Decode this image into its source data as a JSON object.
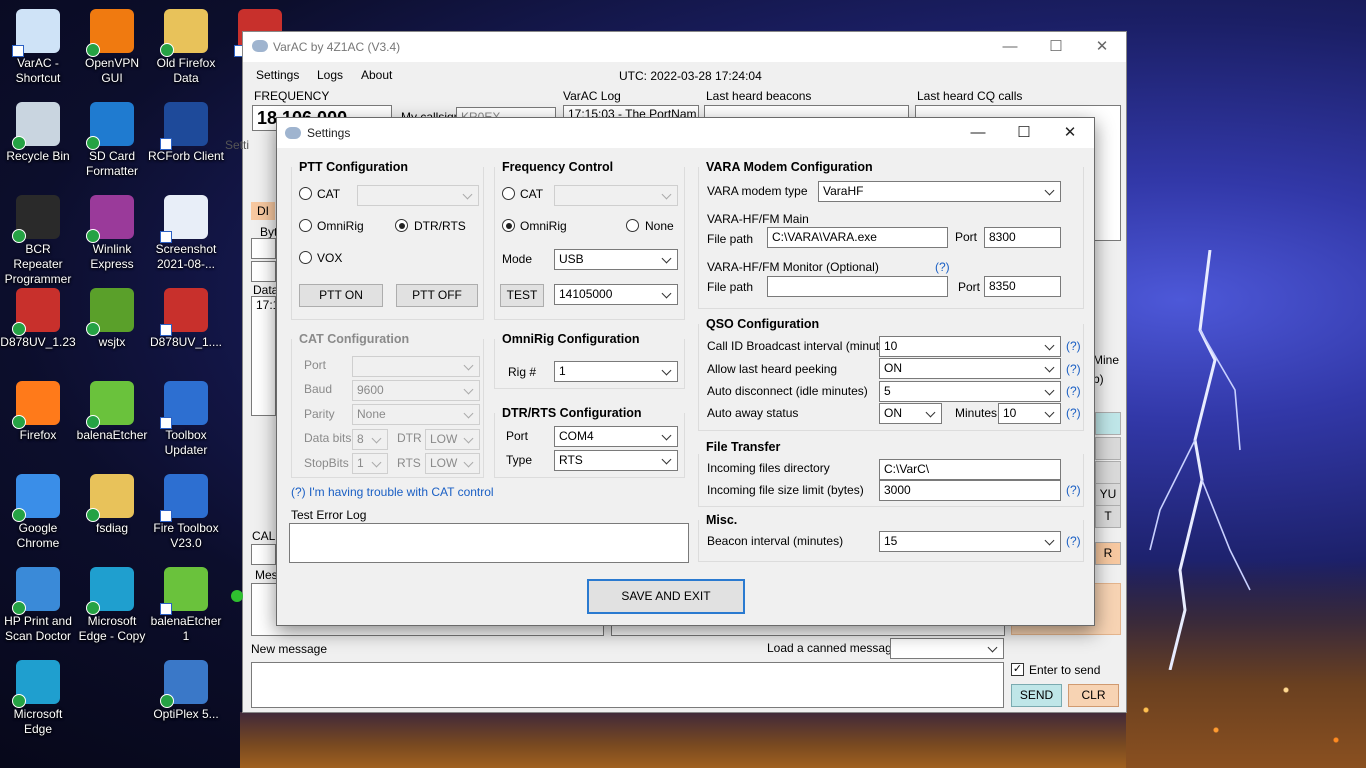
{
  "desktop": {
    "icons": [
      {
        "label": "VarAC - Shortcut",
        "icon": "chat-bubbles-icon",
        "color": "#cfe3f7"
      },
      {
        "label": "OpenVPN GUI",
        "icon": "openvpn-icon",
        "color": "#f07a10"
      },
      {
        "label": "Old Firefox Data",
        "icon": "folder-icon",
        "color": "#e8c25a"
      },
      {
        "label": "D8",
        "icon": "anytone-icon",
        "color": "#c8302c"
      },
      {
        "label": "Recycle Bin",
        "icon": "recycle-bin-icon",
        "color": "#c9d5e0"
      },
      {
        "label": "SD Card Formatter",
        "icon": "sd-card-icon",
        "color": "#1f7bd0"
      },
      {
        "label": "RCForb Client",
        "icon": "rcforb-icon",
        "color": "#1e4a9a"
      },
      {
        "label": "BCR Repeater Programmer",
        "icon": "radio-tower-icon",
        "color": "#2a2a2a"
      },
      {
        "label": "Winlink Express",
        "icon": "winlink-icon",
        "color": "#9a3a9a"
      },
      {
        "label": "Screenshot 2021-08-...",
        "icon": "screenshot-icon",
        "color": "#e8eef8"
      },
      {
        "label": "D878UV_1.23",
        "icon": "anytone-icon",
        "color": "#c8302c"
      },
      {
        "label": "wsjtx",
        "icon": "wsjtx-icon",
        "color": "#5aa02a"
      },
      {
        "label": "D878UV_1....",
        "icon": "anytone-icon",
        "color": "#c8302c"
      },
      {
        "label": "Firefox",
        "icon": "firefox-icon",
        "color": "#ff7a1a"
      },
      {
        "label": "balenaEtcher",
        "icon": "balena-cube-icon",
        "color": "#6ac23c"
      },
      {
        "label": "Toolbox Updater",
        "icon": "toolbox-icon",
        "color": "#2d6fd1"
      },
      {
        "label": "Google Chrome",
        "icon": "chrome-icon",
        "color": "#3a8ee8"
      },
      {
        "label": "fsdiag",
        "icon": "zip-folder-icon",
        "color": "#e8c25a"
      },
      {
        "label": "Fire Toolbox V23.0",
        "icon": "toolbox-icon",
        "color": "#2d6fd1"
      },
      {
        "label": "HP Print and Scan Doctor",
        "icon": "hp-printer-icon",
        "color": "#3a8ad8"
      },
      {
        "label": "Microsoft Edge - Copy",
        "icon": "edge-icon",
        "color": "#1f9fcf"
      },
      {
        "label": "balenaEtcher 1",
        "icon": "balena-cube-icon",
        "color": "#6ac23c"
      },
      {
        "label": "Microsoft Edge",
        "icon": "edge-icon",
        "color": "#1f9fcf"
      },
      {
        "label": "OptiPlex 5...",
        "icon": "optiplex-icon",
        "color": "#3a78c8"
      }
    ]
  },
  "main": {
    "title": "VarAC by 4Z1AC (V3.4)",
    "menu": [
      "Settings",
      "Logs",
      "About"
    ],
    "utc": "UTC: 2022-03-28 17:24:04",
    "frequency_label": "FREQUENCY",
    "frequency_value": "18.106.000",
    "callsign_label": "My callsign",
    "callsign_value": "KR0EX",
    "varac_log_label": "VarAC Log",
    "varac_log_entry": "17:15:03 - The PortNam",
    "beacons_label": "Last heard beacons",
    "cq_label": "Last heard CQ calls",
    "new_message_label": "New message",
    "canned_label": "Load a canned message",
    "enter_to_send": "Enter to send",
    "send_btn": "SEND",
    "clr_btn": "CLR",
    "partial": {
      "sett": "Setti",
      "byte": "Byte",
      "data": "Data",
      "time": "17:1",
      "call": "CALL",
      "mess": "Mess",
      "di": "DI",
      "mine": "Mine",
      "b": "b)",
      "yu": "YU",
      "t": "T",
      "r": "R"
    }
  },
  "settings": {
    "title": "Settings",
    "ptt": {
      "title": "PTT Configuration",
      "cat": "CAT",
      "omnirig": "OmniRig",
      "dtr_rts": "DTR/RTS",
      "vox": "VOX",
      "ptt_on": "PTT ON",
      "ptt_off": "PTT OFF",
      "selected": "DTR/RTS"
    },
    "freq": {
      "title": "Frequency Control",
      "cat": "CAT",
      "omnirig": "OmniRig",
      "none": "None",
      "mode_label": "Mode",
      "mode": "USB",
      "test_btn": "TEST",
      "test_freq": "14105000"
    },
    "cat": {
      "title": "CAT Configuration",
      "port": "Port",
      "baud": "Baud",
      "baud_val": "9600",
      "parity": "Parity",
      "parity_val": "None",
      "databits": "Data bits",
      "databits_val": "8",
      "dtr": "DTR",
      "dtr_val": "LOW",
      "stopbits": "StopBits",
      "stopbits_val": "1",
      "rts": "RTS",
      "rts_val": "LOW"
    },
    "omnirig": {
      "title": "OmniRig Configuration",
      "rig_label": "Rig #",
      "rig": "1"
    },
    "dtr": {
      "title": "DTR/RTS Configuration",
      "port_label": "Port",
      "port": "COM4",
      "type_label": "Type",
      "type": "RTS"
    },
    "trouble": "(?) I'm having trouble with CAT control",
    "error_log": "Test Error Log",
    "vara": {
      "title": "VARA Modem Configuration",
      "type_label": "VARA modem type",
      "type": "VaraHF",
      "main_label": "VARA-HF/FM Main",
      "file_path": "File path",
      "main_path": "C:\\VARA\\VARA.exe",
      "port": "Port",
      "main_port": "8300",
      "monitor_label": "VARA-HF/FM Monitor (Optional)",
      "help": "(?)",
      "mon_path": "",
      "mon_port": "8350"
    },
    "qso": {
      "title": "QSO Configuration",
      "callid_label": "Call ID Broadcast interval (minutes)",
      "callid": "10",
      "peek_label": "Allow last heard peeking",
      "peek": "ON",
      "autodisc_label": "Auto disconnect (idle minutes)",
      "autodisc": "5",
      "away_label": "Auto away status",
      "away": "ON",
      "minutes_label": "Minutes",
      "minutes": "10",
      "help": "(?)"
    },
    "ft": {
      "title": "File Transfer",
      "dir_label": "Incoming files directory",
      "dir": "C:\\VarC\\",
      "limit_label": "Incoming file size limit (bytes)",
      "limit": "3000"
    },
    "misc": {
      "title": "Misc.",
      "beacon_label": "Beacon interval (minutes)",
      "beacon": "15"
    },
    "save_btn": "SAVE AND EXIT"
  }
}
